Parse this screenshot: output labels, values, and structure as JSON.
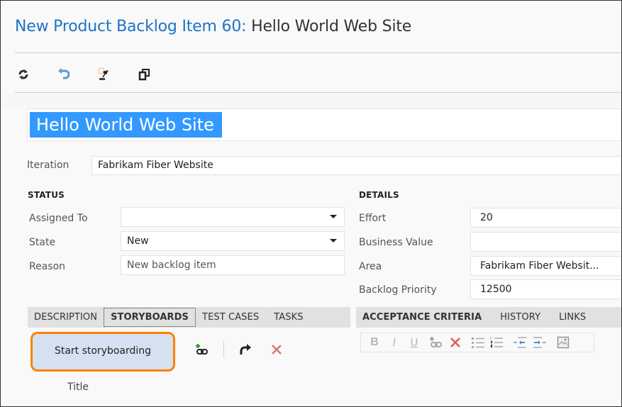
{
  "header": {
    "prefix": "New Product Backlog Item 60:",
    "name": "Hello World Web Site"
  },
  "toolbar": {
    "icons": [
      "refresh-icon",
      "undo-icon",
      "new-linked-item-icon",
      "copy-icon"
    ]
  },
  "work_item": {
    "title": "Hello World Web Site",
    "iteration_label": "Iteration",
    "iteration_value": "Fabrikam Fiber Website"
  },
  "status": {
    "heading": "STATUS",
    "assigned_to_label": "Assigned To",
    "assigned_to_value": "",
    "state_label": "State",
    "state_value": "New",
    "reason_label": "Reason",
    "reason_value": "New backlog item"
  },
  "details": {
    "heading": "DETAILS",
    "effort_label": "Effort",
    "effort_value": "20",
    "business_value_label": "Business Value",
    "business_value_value": "",
    "area_label": "Area",
    "area_value": "Fabrikam Fiber Websit...",
    "backlog_priority_label": "Backlog Priority",
    "backlog_priority_value": "12500"
  },
  "left_tabs": [
    {
      "label": "DESCRIPTION",
      "active": false
    },
    {
      "label": "STORYBOARDS",
      "active": true
    },
    {
      "label": "TEST CASES",
      "active": false
    },
    {
      "label": "TASKS",
      "active": false
    }
  ],
  "right_tabs": [
    {
      "label": "ACCEPTANCE CRITERIA",
      "active": true
    },
    {
      "label": "HISTORY",
      "active": false
    },
    {
      "label": "LINKS",
      "active": false
    }
  ],
  "storyboards": {
    "start_button": "Start storyboarding",
    "column_title": "Title"
  },
  "rich_text": {
    "bold": "B",
    "italic": "I",
    "underline": "U"
  },
  "colors": {
    "accent_blue": "#1e73c8",
    "selection": "#3399ff",
    "highlight_orange": "#ff8000",
    "button_bg": "#d5e1f1"
  }
}
